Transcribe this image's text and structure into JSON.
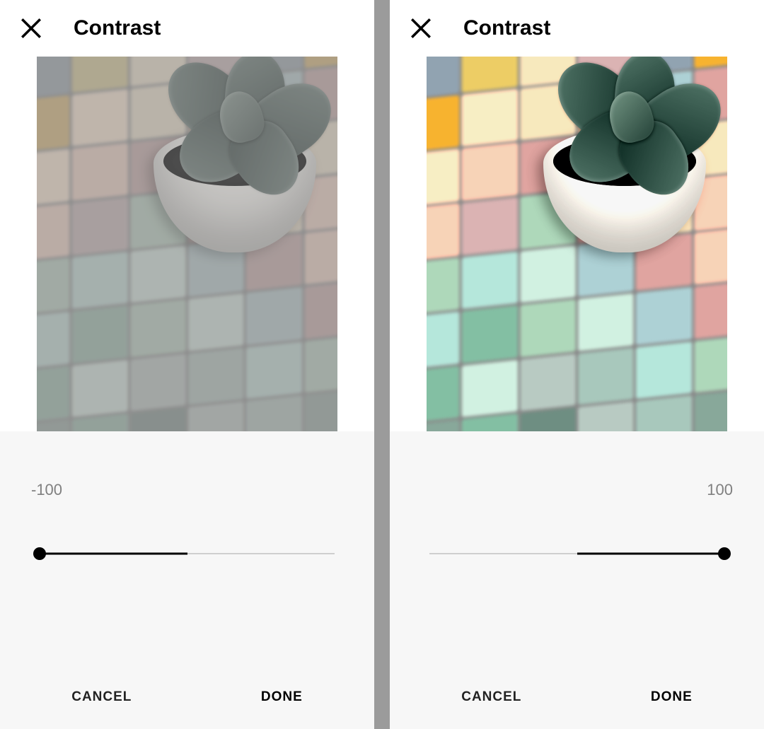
{
  "slider": {
    "min": -100,
    "max": 100,
    "center": 0
  },
  "panes": [
    {
      "title": "Contrast",
      "value": -100,
      "value_display": "-100",
      "value_align": "left",
      "thumb_percent": 0,
      "track_active_from": 0,
      "track_active_to": 50,
      "track_inactive_from": 50,
      "track_inactive_to": 100,
      "contrast_class": "lo-contrast",
      "buttons": {
        "cancel": "CANCEL",
        "done": "DONE"
      }
    },
    {
      "title": "Contrast",
      "value": 100,
      "value_display": "100",
      "value_align": "right",
      "thumb_percent": 100,
      "track_active_from": 50,
      "track_active_to": 100,
      "track_inactive_from": 0,
      "track_inactive_to": 50,
      "contrast_class": "hi-contrast",
      "buttons": {
        "cancel": "CANCEL",
        "done": "DONE"
      }
    }
  ]
}
